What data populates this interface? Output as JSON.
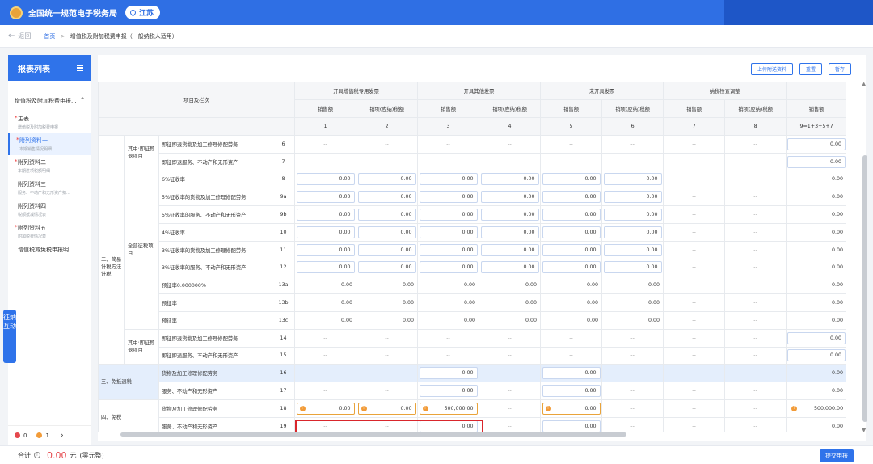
{
  "header": {
    "brand": "全国统一规范电子税务局",
    "province": "江苏"
  },
  "breadcrumb": {
    "back": "返回",
    "home": "首页",
    "current": "增值税及附加税费申报（一般纳税人适用）"
  },
  "sidebar": {
    "title": "报表列表",
    "group": "增值税及附加税费申报...",
    "items": [
      {
        "title": "主表",
        "sub": "增值税及附加税费申报",
        "required": true,
        "active": false
      },
      {
        "title": "附列资料一",
        "sub": "本期销售情况明细",
        "required": true,
        "active": true
      },
      {
        "title": "附列资料二",
        "sub": "本期进项税额明细",
        "required": true,
        "active": false
      },
      {
        "title": "附列资料三",
        "sub": "服务、不动产和无形资产扣...",
        "required": false,
        "active": false
      },
      {
        "title": "附列资料四",
        "sub": "税额抵减情况表",
        "required": false,
        "active": false
      },
      {
        "title": "附列资料五",
        "sub": "附加税费情况表",
        "required": true,
        "active": false
      },
      {
        "title": "增值税减免税申报明...",
        "sub": "",
        "required": false,
        "active": false
      }
    ],
    "footer": {
      "errors": "0",
      "warnings": "1"
    }
  },
  "float_tab": "征纳互动",
  "actions": {
    "upload": "上传附送资料",
    "reset": "重置",
    "save": "暂存"
  },
  "table": {
    "col_item": "项目及栏次",
    "groups": [
      "开具增值税专用发票",
      "开具其他发票",
      "未开具发票",
      "纳税检查调整"
    ],
    "sub_sales": "销售额",
    "sub_tax": "销项(应纳)税额",
    "col_nums": [
      "1",
      "2",
      "3",
      "4",
      "5",
      "6",
      "7",
      "8",
      "9=1+3+5+7"
    ],
    "g_jizheng": "其中:即征即退项目",
    "g_jianyi_a": "二、简易计税方法计税",
    "g_quanbu": "全部征税项目",
    "g_jizheng2": "其中:即征即退项目",
    "g_mian_di": "三、免抵退税",
    "g_mian": "四、免税",
    "dash": "--",
    "r6": {
      "label": "即征即退货物及加工修理修配劳务",
      "num": "6",
      "total": "0.00"
    },
    "r7": {
      "label": "即征即退服务、不动产和无形资产",
      "num": "7",
      "total": "0.00"
    },
    "r8": {
      "label": "6%征收率",
      "num": "8",
      "v": "0.00"
    },
    "r9a": {
      "label": "5%征收率的货物及加工修理修配劳务",
      "num": "9a",
      "v": "0.00"
    },
    "r9b": {
      "label": "5%征收率的服务、不动产和无形资产",
      "num": "9b",
      "v": "0.00"
    },
    "r10": {
      "label": "4%征收率",
      "num": "10",
      "v": "0.00"
    },
    "r11": {
      "label": "3%征收率的货物及加工修理修配劳务",
      "num": "11",
      "v": "0.00"
    },
    "r12": {
      "label": "3%征收率的服务、不动产和无形资产",
      "num": "12",
      "v": "0.00"
    },
    "r13a": {
      "label": "预征率0.000000%",
      "num": "13a",
      "v": "0.00"
    },
    "r13b": {
      "label": "预征率",
      "num": "13b",
      "v": "0.00"
    },
    "r13c": {
      "label": "预征率",
      "num": "13c",
      "v": "0.00"
    },
    "r14": {
      "label": "即征即退货物及加工修理修配劳务",
      "num": "14",
      "total": "0.00"
    },
    "r15": {
      "label": "即征即退服务、不动产和无形资产",
      "num": "15",
      "total": "0.00"
    },
    "r16": {
      "label": "货物及加工修理修配劳务",
      "num": "16",
      "v": "0.00"
    },
    "r17": {
      "label": "服务、不动产和无形资产",
      "num": "17",
      "v": "0.00"
    },
    "r18": {
      "label": "货物及加工修理修配劳务",
      "num": "18",
      "c1": "0.00",
      "c2": "0.00",
      "c3": "500,000.00",
      "c5": "0.00",
      "total": "500,000.00"
    },
    "r19": {
      "label": "服务、不动产和无形资产",
      "num": "19",
      "v": "0.00"
    }
  },
  "bottom": {
    "total_label": "合计",
    "total_value": "0.00",
    "unit": "元",
    "unit_note": "(零元整)",
    "submit": "提交申报"
  },
  "colors": {
    "brand": "#2f6fe4",
    "accent": "#2f73ea",
    "error": "#e5484d",
    "warning": "#f29b38"
  }
}
